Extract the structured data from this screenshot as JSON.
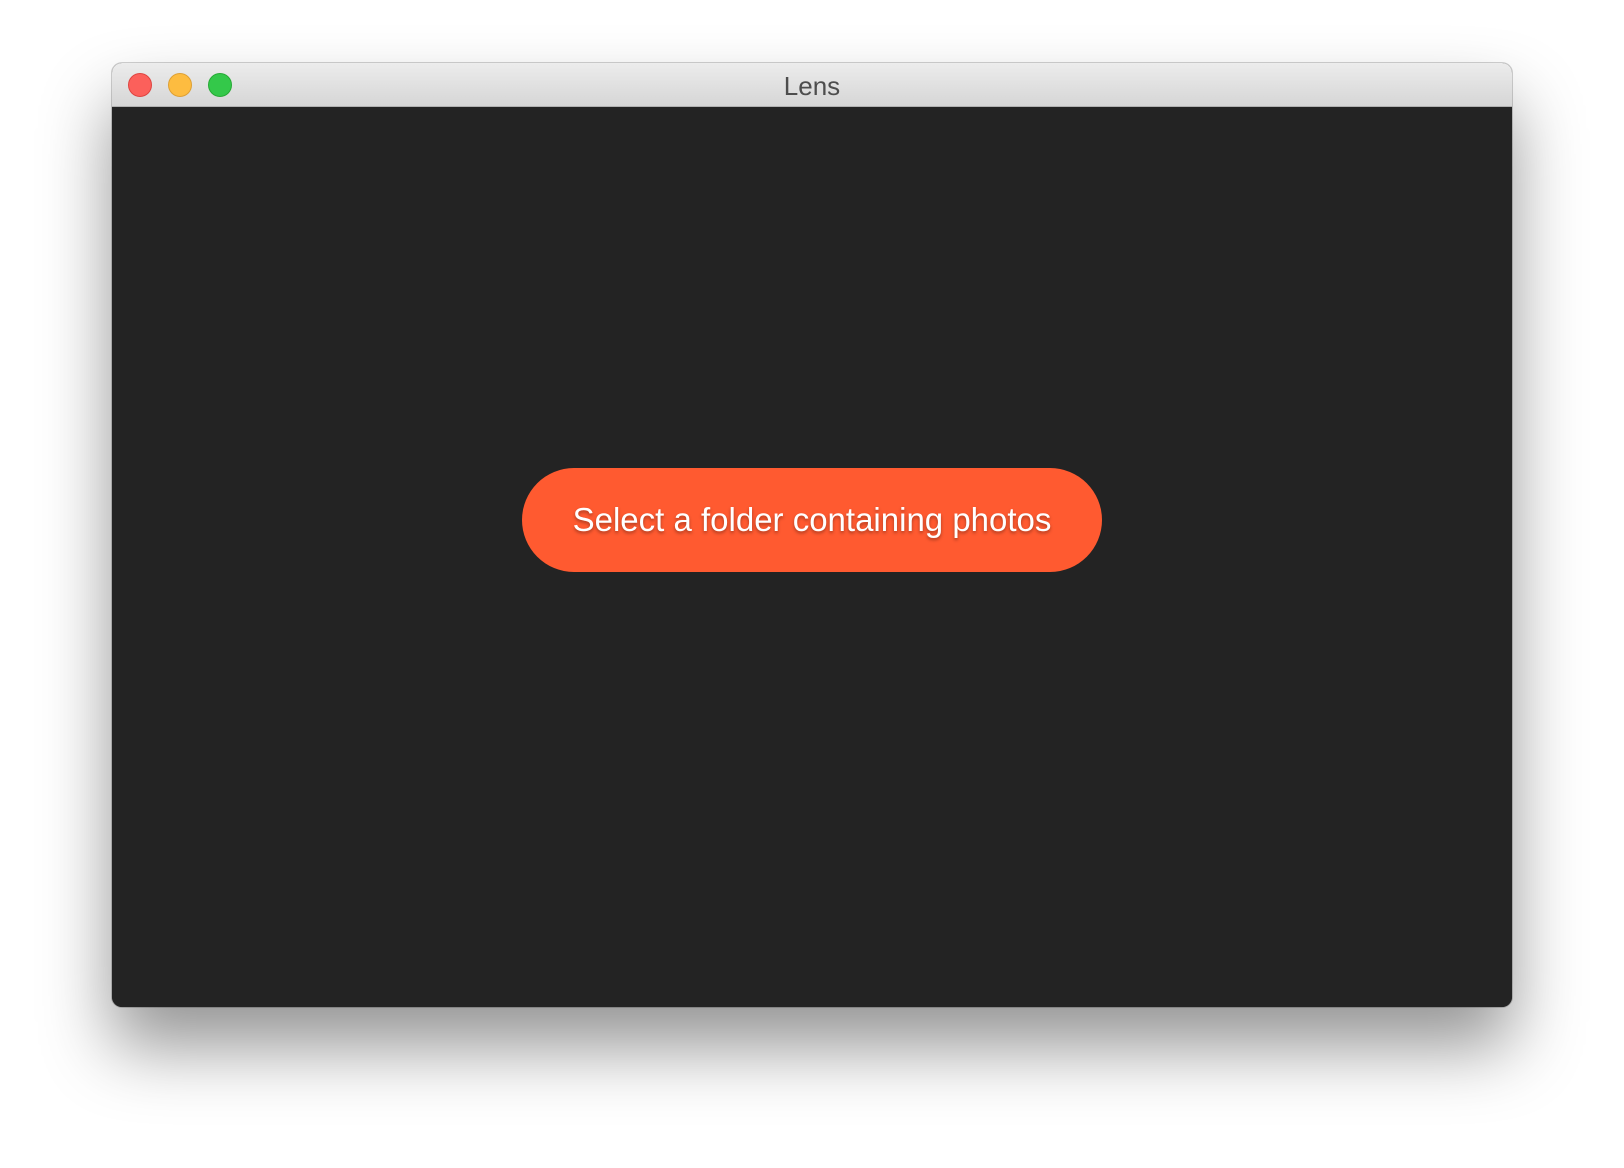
{
  "window": {
    "title": "Lens"
  },
  "titlebar": {
    "controls": {
      "close": "traffic-light-close",
      "minimize": "traffic-light-minimize",
      "zoom": "traffic-light-zoom"
    }
  },
  "main": {
    "primary_button_label": "Select a folder containing photos"
  },
  "colors": {
    "content_background": "#232323",
    "accent": "#ff5a30",
    "close": "#fc605b",
    "minimize": "#fdbc40",
    "zoom": "#34c84a"
  }
}
